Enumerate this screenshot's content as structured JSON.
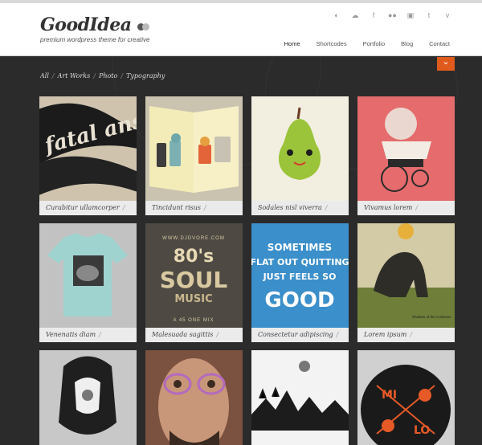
{
  "logo": {
    "title": "GoodIdea",
    "tagline": "premium wordpress theme for creative"
  },
  "social_icons": [
    "chat-icon",
    "cloud-icon",
    "facebook-icon",
    "flickr-icon",
    "pages-icon",
    "twitter-icon",
    "vimeo-icon"
  ],
  "social_glyphs": [
    "◐",
    "☁",
    "f",
    "●●",
    "▣",
    "t",
    "v"
  ],
  "nav": [
    {
      "label": "Home",
      "active": true
    },
    {
      "label": "Shortcodes",
      "active": false
    },
    {
      "label": "Portfolio",
      "active": false
    },
    {
      "label": "Blog",
      "active": false
    },
    {
      "label": "Contact",
      "active": false
    }
  ],
  "filters": [
    "All",
    "Art Works",
    "Photo",
    "Typography"
  ],
  "toggle_icon": "chevron-down-icon",
  "toggle_glyph": "⌄",
  "accent_color": "#e05a1c",
  "portfolio": [
    {
      "caption": "Curabitur ullamcorper"
    },
    {
      "caption": "Tincidunt risus"
    },
    {
      "caption": "Sodales nisl viverra"
    },
    {
      "caption": "Vivamus lorem"
    },
    {
      "caption": "Venenatis diam"
    },
    {
      "caption": "Malesuada sagittis"
    },
    {
      "caption": "Consectetur adipiscing"
    },
    {
      "caption": "Lorem ipsum"
    },
    {
      "caption": ""
    },
    {
      "caption": ""
    },
    {
      "caption": ""
    },
    {
      "caption": ""
    }
  ],
  "artwork_text": {
    "soul_top": "WWW.DJDVORE.COM",
    "soul_80s": "80's",
    "soul_word": "SOUL",
    "soul_music": "MUSIC",
    "soul_bottom": "A 45 ONE MIX",
    "poster_top": "SOMETIMES",
    "poster_mid": "FLAT OUT QUITTING",
    "poster_line3": "JUST FEELS SO",
    "poster_good": "GOOD",
    "shadow_caption": "Shadow of the Colossus",
    "milo_left": "MI",
    "milo_right": "LO",
    "typo_word": "fatal ansor"
  }
}
